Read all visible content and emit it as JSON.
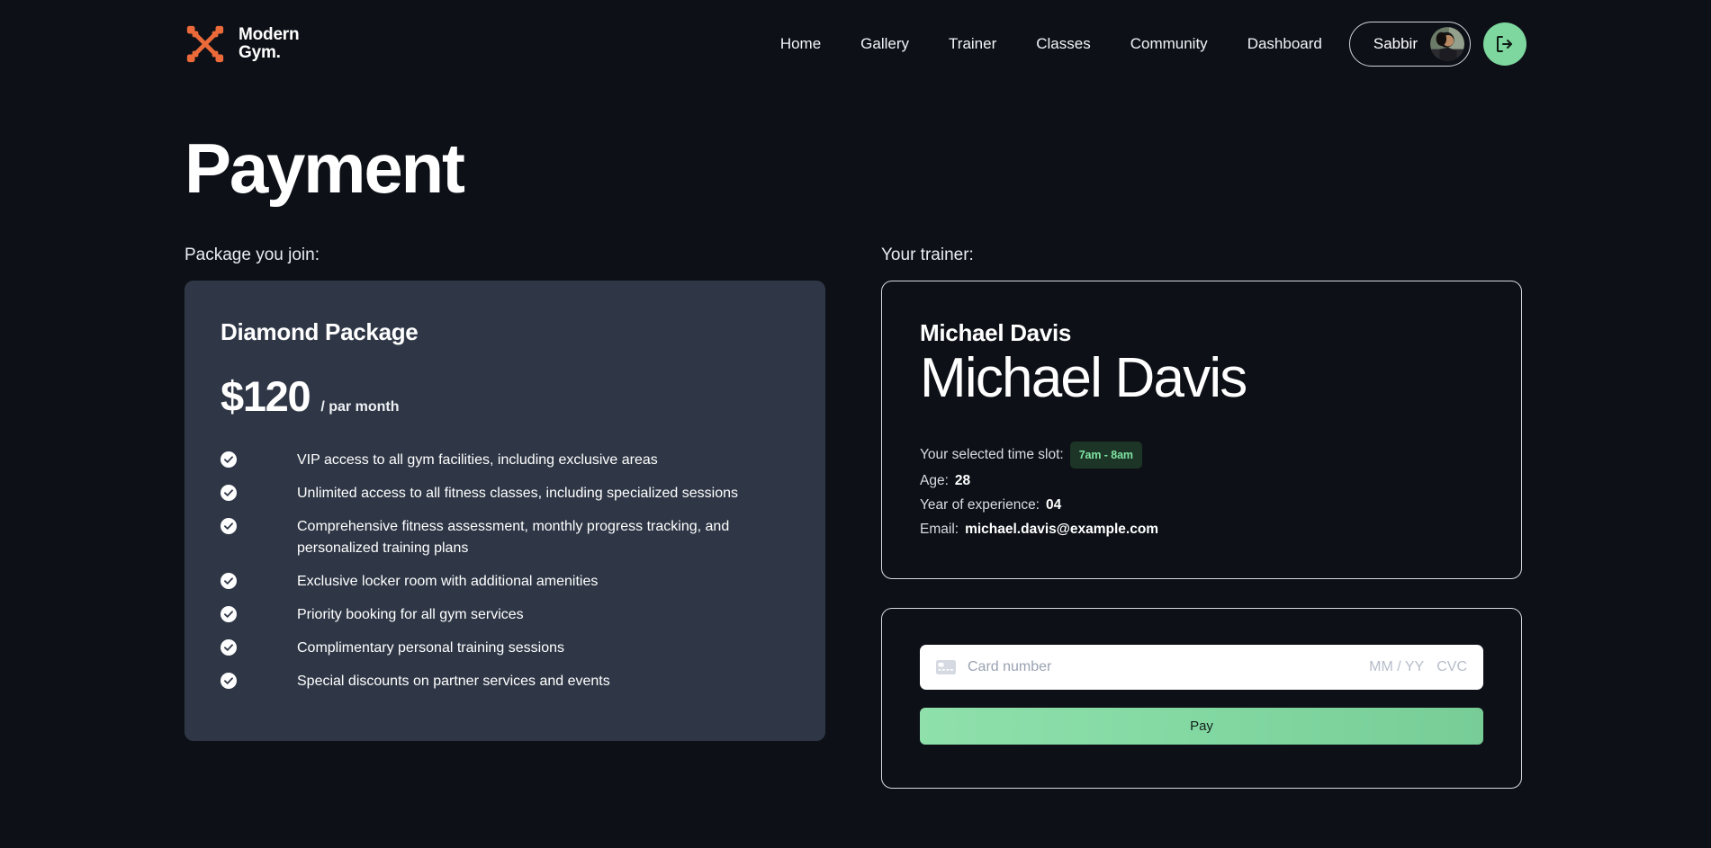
{
  "brand": {
    "name": "Modern\nGym.",
    "logo_icon": "crossed-dumbbells-icon",
    "logo_color": "#ec6a3a"
  },
  "nav": {
    "links": [
      {
        "label": "Home"
      },
      {
        "label": "Gallery"
      },
      {
        "label": "Trainer"
      },
      {
        "label": "Classes"
      },
      {
        "label": "Community"
      },
      {
        "label": "Dashboard"
      }
    ],
    "user": {
      "name": "Sabbir",
      "avatar_icon": "user-avatar-photo"
    },
    "logout": {
      "icon": "logout-icon",
      "color": "#7ed79f"
    }
  },
  "page": {
    "title": "Payment",
    "background": "#0d1117"
  },
  "left": {
    "section_label": "Package you join:",
    "package": {
      "name": "Diamond Package",
      "price": "$120",
      "period": "/ par month",
      "card_background": "#2f3746",
      "check_icon": "check-circle-icon",
      "features": [
        "VIP access to all gym facilities, including exclusive areas",
        "Unlimited access to all fitness classes, including specialized sessions",
        "Comprehensive fitness assessment, monthly progress tracking, and personalized training plans",
        "Exclusive locker room with additional amenities",
        "Priority booking for all gym services",
        "Complimentary personal training sessions",
        "Special discounts on partner services and events"
      ]
    }
  },
  "right": {
    "section_label": "Your trainer:",
    "trainer": {
      "name_small": "Michael Davis",
      "name_large": "Michael Davis",
      "time_slot_label": "Your selected time slot:",
      "time_slot_value": "7am - 8am",
      "time_slot_color": "#7ee2a0",
      "age_label": "Age:",
      "age_value": "28",
      "experience_label": "Year of experience:",
      "experience_value": "04",
      "email_label": "Email:",
      "email_value": "michael.davis@example.com"
    },
    "payment": {
      "card_icon": "credit-card-icon",
      "card_placeholder": "Card number",
      "expiry_placeholder": "MM / YY",
      "cvc_placeholder": "CVC",
      "pay_label": "Pay",
      "pay_color": "#84d9a3"
    }
  }
}
